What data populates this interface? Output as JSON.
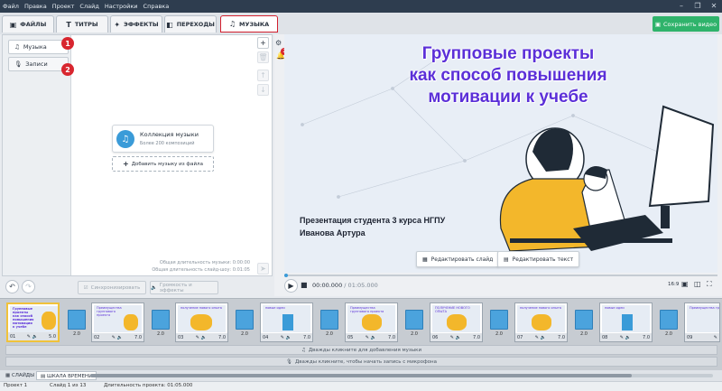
{
  "menubar": {
    "items": [
      "Файл",
      "Правка",
      "Проект",
      "Слайд",
      "Настройки",
      "Справка"
    ]
  },
  "tabs": [
    {
      "label": "ФАЙЛЫ",
      "icon": "film-icon"
    },
    {
      "label": "ТИТРЫ",
      "icon": "title-t-icon"
    },
    {
      "label": "ЭФФЕКТЫ",
      "icon": "effects-star-icon"
    },
    {
      "label": "ПЕРЕХОДЫ",
      "icon": "transitions-icon"
    },
    {
      "label": "МУЗЫКА",
      "icon": "music-note-icon",
      "active": true
    }
  ],
  "save_button": "Сохранить видео",
  "left_panel": {
    "categories": [
      {
        "label": "Музыка",
        "badge": "1",
        "icon": "music-note-icon"
      },
      {
        "label": "Записи",
        "badge": "2",
        "icon": "microphone-icon"
      }
    ],
    "collection": {
      "title": "Коллекция музыки",
      "subtitle": "Более 200 композиций"
    },
    "add_music": "Добавить музыку из файла",
    "music_duration": "Общая длительность музыки: 0:00:00",
    "slides_duration": "Общая длительность слайд-шоу: 0:01:05"
  },
  "left_bottom": {
    "sync": "Синхронизировать",
    "volume": "Громкость и эффекты"
  },
  "preview_toolbar": {
    "notif_count": "2"
  },
  "slide": {
    "title_lines": [
      "Групповые проекты",
      "как способ повышения",
      "мотивации к учебе"
    ],
    "presenter_lines": [
      "Презентация студента 3 курса НГПУ",
      "Иванова Артура"
    ],
    "edit_slide": "Редактировать слайд",
    "edit_text": "Редактировать текст"
  },
  "playback": {
    "time": "00:00.000",
    "total": "/ 01:05.000",
    "aspect": "16:9"
  },
  "timeline": {
    "slides": [
      {
        "num": "01",
        "dur": "5.0",
        "caption": "Групповые проекты как способ повышения мотивации к учебе"
      },
      {
        "num": "02",
        "dur": "7.0",
        "caption": "Преимущества группового проекта"
      },
      {
        "num": "03",
        "dur": "7.0",
        "caption": "получение нового опыта"
      },
      {
        "num": "04",
        "dur": "7.0",
        "caption": "новые идеи"
      },
      {
        "num": "05",
        "dur": "7.0",
        "caption": "Преимущества группового проекта"
      },
      {
        "num": "06",
        "dur": "7.0",
        "caption": "ПОЛУЧЕНИЕ НОВОГО ОПЫТА"
      },
      {
        "num": "07",
        "dur": "7.0",
        "caption": "получение нового опыта"
      },
      {
        "num": "08",
        "dur": "7.0",
        "caption": "новые идеи"
      },
      {
        "num": "09",
        "dur": "7.0",
        "caption": "Преимущества группового проекта"
      }
    ],
    "transition_duration": "2.0",
    "music_track": "Дважды кликните для добавления музыки",
    "record_track": "Дважды кликните, чтобы начать запись с микрофона"
  },
  "view_tabs": {
    "slides": "СЛАЙДЫ",
    "timeline": "ШКАЛА ВРЕМЕНИ"
  },
  "status": {
    "project": "Проект 1",
    "slide": "Слайд 1 из 13",
    "duration": "Длительность проекта: 01:05.000"
  },
  "colors": {
    "accent": "#2fb36b",
    "active_tab_border": "#d21f2e",
    "badge": "#d8262f",
    "title": "#5b2fd8",
    "transition": "#4ba3dd"
  }
}
